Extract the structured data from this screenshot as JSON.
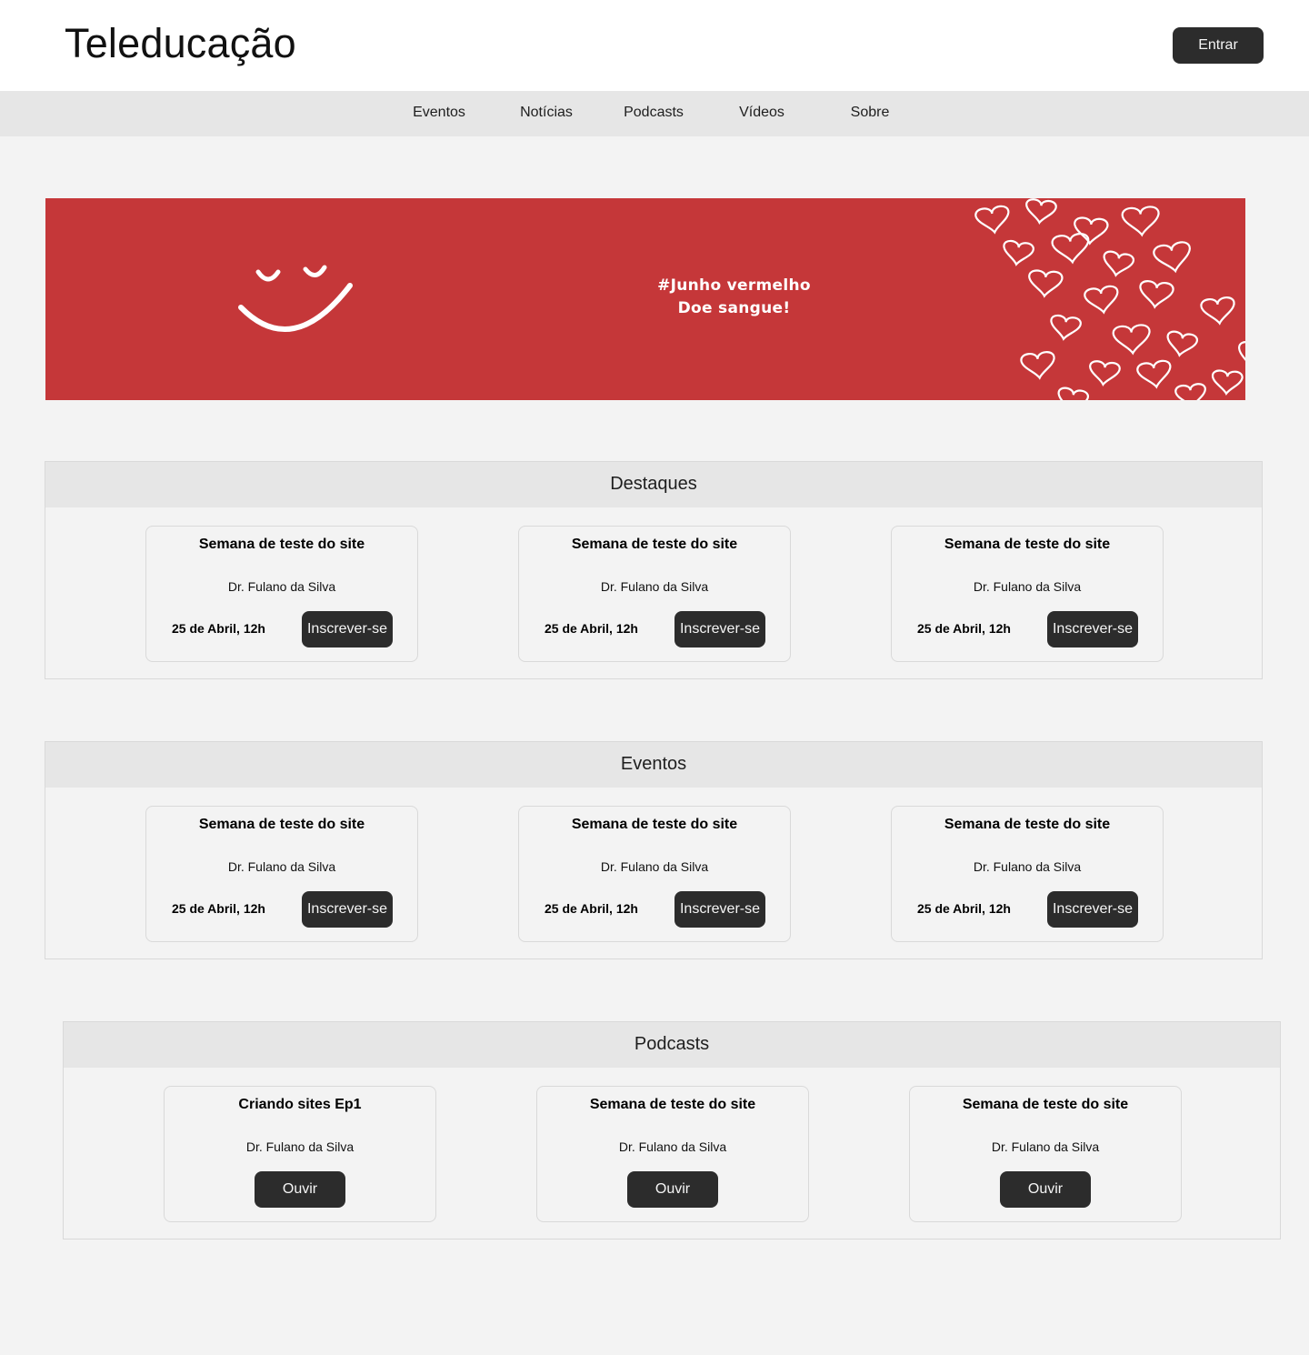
{
  "header": {
    "site_title": "Teleducação",
    "login_label": "Entrar"
  },
  "nav": {
    "items": [
      "Eventos",
      "Notícias",
      "Podcasts",
      "Vídeos",
      "Sobre"
    ]
  },
  "banner": {
    "line1": "#Junho vermelho",
    "line2": "Doe sangue!",
    "background_color": "#c53739",
    "decorations": [
      "smiley-face",
      "hearts-pattern"
    ]
  },
  "sections": [
    {
      "title": "Destaques",
      "cards": [
        {
          "title": "Semana de teste do site",
          "author": "Dr. Fulano da Silva",
          "date": "25 de Abril, 12h",
          "button": "Inscrever-se"
        },
        {
          "title": "Semana de teste do site",
          "author": "Dr. Fulano da Silva",
          "date": "25 de Abril, 12h",
          "button": "Inscrever-se"
        },
        {
          "title": "Semana de teste do site",
          "author": "Dr. Fulano da Silva",
          "date": "25 de Abril, 12h",
          "button": "Inscrever-se"
        }
      ]
    },
    {
      "title": "Eventos",
      "cards": [
        {
          "title": "Semana de teste do site",
          "author": "Dr. Fulano da Silva",
          "date": "25 de Abril, 12h",
          "button": "Inscrever-se"
        },
        {
          "title": "Semana de teste do site",
          "author": "Dr. Fulano da Silva",
          "date": "25 de Abril, 12h",
          "button": "Inscrever-se"
        },
        {
          "title": "Semana de teste do site",
          "author": "Dr. Fulano da Silva",
          "date": "25 de Abril, 12h",
          "button": "Inscrever-se"
        }
      ]
    },
    {
      "title": "Podcasts",
      "cards": [
        {
          "title": "Criando sites Ep1",
          "author": "Dr. Fulano da Silva",
          "button": "Ouvir"
        },
        {
          "title": "Semana de teste do site",
          "author": "Dr. Fulano da Silva",
          "button": "Ouvir"
        },
        {
          "title": "Semana de teste do site",
          "author": "Dr. Fulano da Silva",
          "button": "Ouvir"
        }
      ]
    }
  ],
  "colors": {
    "button": "#2c2c2c",
    "page_background": "#f3f3f3",
    "nav_background": "#e6e6e6"
  }
}
